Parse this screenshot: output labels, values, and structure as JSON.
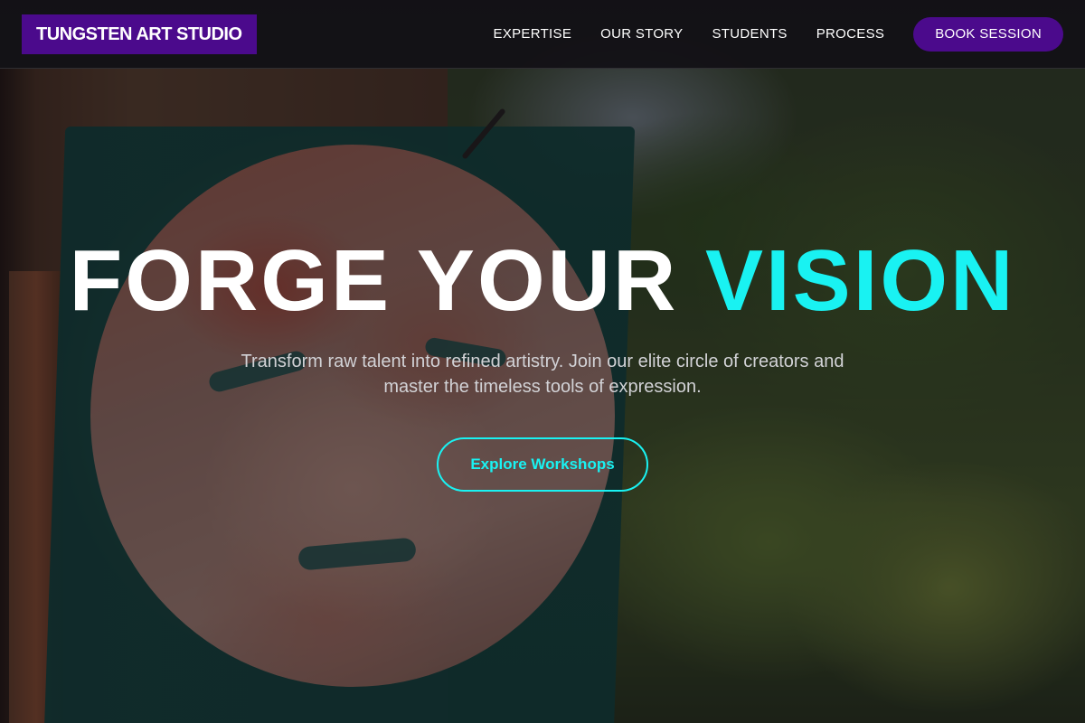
{
  "brand": {
    "name": "TUNGSTEN ART STUDIO",
    "accent_color": "#4b0a8c",
    "highlight_color": "#19f2f2"
  },
  "nav": {
    "items": [
      {
        "label": "EXPERTISE"
      },
      {
        "label": "OUR STORY"
      },
      {
        "label": "STUDENTS"
      },
      {
        "label": "PROCESS"
      }
    ],
    "cta_label": "BOOK SESSION"
  },
  "hero": {
    "title_main": "FORGE YOUR ",
    "title_accent": "VISION",
    "subtitle": "Transform raw talent into refined artistry. Join our elite circle of creators and master the timeless tools of expression.",
    "cta_label": "Explore Workshops"
  }
}
